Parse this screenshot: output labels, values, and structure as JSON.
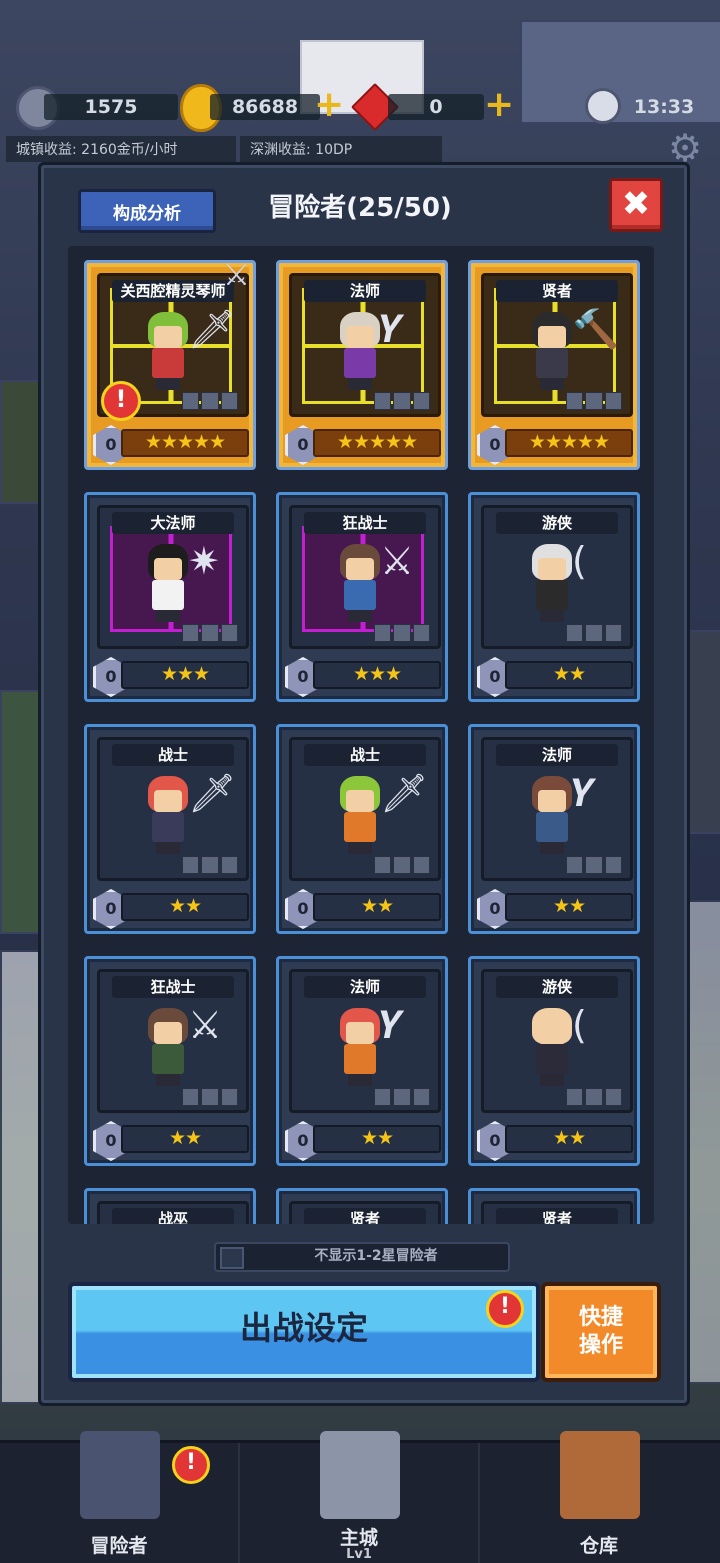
{
  "hud": {
    "moon_value": "1575",
    "gold_value": "86688",
    "gem_value": "0",
    "time": "13:33",
    "town_income": "城镇收益: 2160金币/小时",
    "abyss_income": "深渊收益: 10DP"
  },
  "panel": {
    "analysis_button": "构成分析",
    "title": "冒险者(25/50)",
    "close_label": "✖",
    "filter_label": "不显示1-2星冒险者",
    "sortie_button": "出战设定",
    "quick_line1": "快捷",
    "quick_line2": "操作"
  },
  "cards": [
    {
      "name": "关西腔精灵琴师",
      "level": "0",
      "stars": "★★★★★",
      "hair": "#7fbf3a",
      "body": "#c93a3a",
      "weapon": "🗡",
      "style": "gold"
    },
    {
      "name": "法师",
      "level": "0",
      "stars": "★★★★★",
      "hair": "#d9d2c4",
      "body": "#7a3aa8",
      "weapon": "𝒀",
      "style": "gold"
    },
    {
      "name": "贤者",
      "level": "0",
      "stars": "★★★★★",
      "hair": "#2b2b2b",
      "body": "#3a3a4a",
      "weapon": "🔨",
      "style": "gold"
    },
    {
      "name": "大法师",
      "level": "0",
      "stars": "★★★",
      "hair": "#1d1d1d",
      "body": "#f2f2f2",
      "weapon": "✷",
      "style": "purple"
    },
    {
      "name": "狂战士",
      "level": "0",
      "stars": "★★★",
      "hair": "#6a4a3a",
      "body": "#3a6ab0",
      "weapon": "⚔",
      "style": "purple"
    },
    {
      "name": "游侠",
      "level": "0",
      "stars": "★★",
      "hair": "#e0e0e0",
      "body": "#2b2b2b",
      "weapon": "(",
      "style": "plain"
    },
    {
      "name": "战士",
      "level": "0",
      "stars": "★★",
      "hair": "#e2574a",
      "body": "#3a3a5a",
      "weapon": "🗡",
      "style": "plain"
    },
    {
      "name": "战士",
      "level": "0",
      "stars": "★★",
      "hair": "#8cc63a",
      "body": "#e07a2a",
      "weapon": "🗡",
      "style": "plain"
    },
    {
      "name": "法师",
      "level": "0",
      "stars": "★★",
      "hair": "#7a4a3a",
      "body": "#3a5a8a",
      "weapon": "𝒀",
      "style": "plain"
    },
    {
      "name": "狂战士",
      "level": "0",
      "stars": "★★",
      "hair": "#6a4a3a",
      "body": "#3a5a3a",
      "weapon": "⚔",
      "style": "plain"
    },
    {
      "name": "法师",
      "level": "0",
      "stars": "★★",
      "hair": "#e2574a",
      "body": "#e07a2a",
      "weapon": "𝒀",
      "style": "plain"
    },
    {
      "name": "游侠",
      "level": "0",
      "stars": "★★",
      "hair": "#f3cfa6",
      "body": "#2b2b3a",
      "weapon": "(",
      "style": "plain"
    },
    {
      "name": "战巫",
      "level": "",
      "stars": "",
      "hair": "",
      "body": "",
      "weapon": "",
      "style": "plain"
    },
    {
      "name": "贤者",
      "level": "",
      "stars": "",
      "hair": "",
      "body": "",
      "weapon": "",
      "style": "plain"
    },
    {
      "name": "贤者",
      "level": "",
      "stars": "",
      "hair": "",
      "body": "",
      "weapon": "",
      "style": "plain"
    }
  ],
  "nav": {
    "adventurer": "冒险者",
    "main_city": "主城",
    "main_city_level": "Lv1",
    "warehouse": "仓库"
  },
  "colors": {
    "panel_bg": "#2a3449",
    "card_border": "#4b8fd6",
    "gold_card": "#e89b22",
    "star": "#f5c417",
    "sortie_blue": "#3a90e2",
    "quick_orange": "#f38a2a",
    "close_red": "#e2453f"
  }
}
